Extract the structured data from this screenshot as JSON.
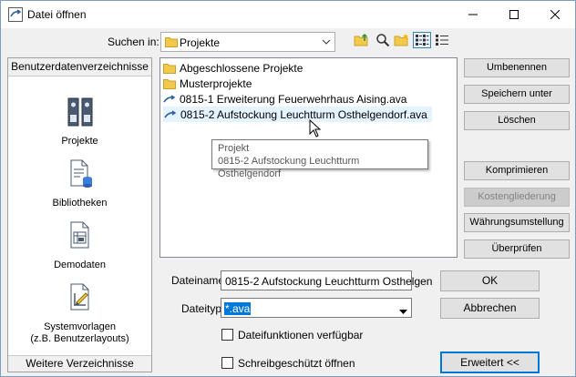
{
  "window": {
    "title": "Datei öffnen"
  },
  "lookin": {
    "label": "Suchen in:",
    "value": "Projekte"
  },
  "toolbar": [
    "folder-up-icon",
    "search-icon",
    "new-folder-icon",
    "list-view-icon",
    "details-view-icon"
  ],
  "leftpanel": {
    "header": "Benutzerdatenverzeichnisse",
    "items": [
      {
        "label": "Projekte",
        "icon": "binder-icon"
      },
      {
        "label": "Bibliotheken",
        "icon": "library-icon"
      },
      {
        "label": "Demodaten",
        "icon": "demo-data-icon"
      },
      {
        "label": "Systemvorlagen",
        "label2": "(z.B. Benutzerlayouts)",
        "icon": "template-icon"
      }
    ],
    "footer": "Weitere Verzeichnisse"
  },
  "files": [
    {
      "name": "Abgeschlossene Projekte",
      "icon": "folder-icon"
    },
    {
      "name": "Musterprojekte",
      "icon": "folder-icon"
    },
    {
      "name": "0815-1 Erweiterung Feuerwehrhaus Aising.ava",
      "icon": "ava-file-icon"
    },
    {
      "name": "0815-2 Aufstockung Leuchtturm Osthelgendorf.ava",
      "icon": "ava-file-icon"
    }
  ],
  "tooltip": {
    "line1": "Projekt",
    "line2": "0815-2 Aufstockung Leuchtturm Osthelgendorf"
  },
  "right_buttons": {
    "rename": "Umbenennen",
    "save_as": "Speichern unter",
    "delete": "Löschen",
    "compress": "Komprimieren",
    "cost_structure": "Kostengliederung",
    "currency": "Währungsumstellung",
    "check": "Überprüfen"
  },
  "filename": {
    "label": "Dateiname",
    "value": "0815-2 Aufstockung Leuchtturm Osthelgen"
  },
  "filetype": {
    "label": "Dateityp",
    "value": "*.ava"
  },
  "options": {
    "file_functions": "Dateifunktionen verfügbar",
    "read_only": "Schreibgeschützt öffnen"
  },
  "actions": {
    "ok": "OK",
    "cancel": "Abbrechen",
    "extended": "Erweitert <<"
  },
  "colors": {
    "accent": "#0078d7",
    "folder": "#f2c94c",
    "selection": "#e5f3ff"
  }
}
